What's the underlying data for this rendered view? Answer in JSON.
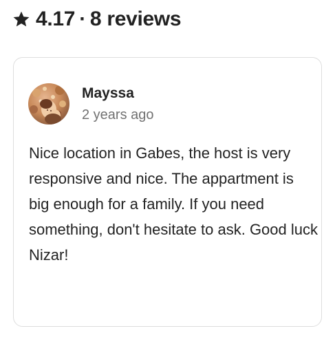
{
  "header": {
    "star_icon": "star-icon",
    "rating": "4.17",
    "separator": "·",
    "reviews_count": "8 reviews"
  },
  "review": {
    "avatar_icon": "avatar-painting",
    "reviewer_name": "Mayssa",
    "date": "2 years ago",
    "text": "Nice location in Gabes, the host is very responsive and nice. The appartment is big enough for a family. If you need something, don't hesitate to ask. Good luck Nizar!"
  },
  "colors": {
    "text_primary": "#222222",
    "text_secondary": "#717171",
    "card_border": "#dddddd"
  }
}
